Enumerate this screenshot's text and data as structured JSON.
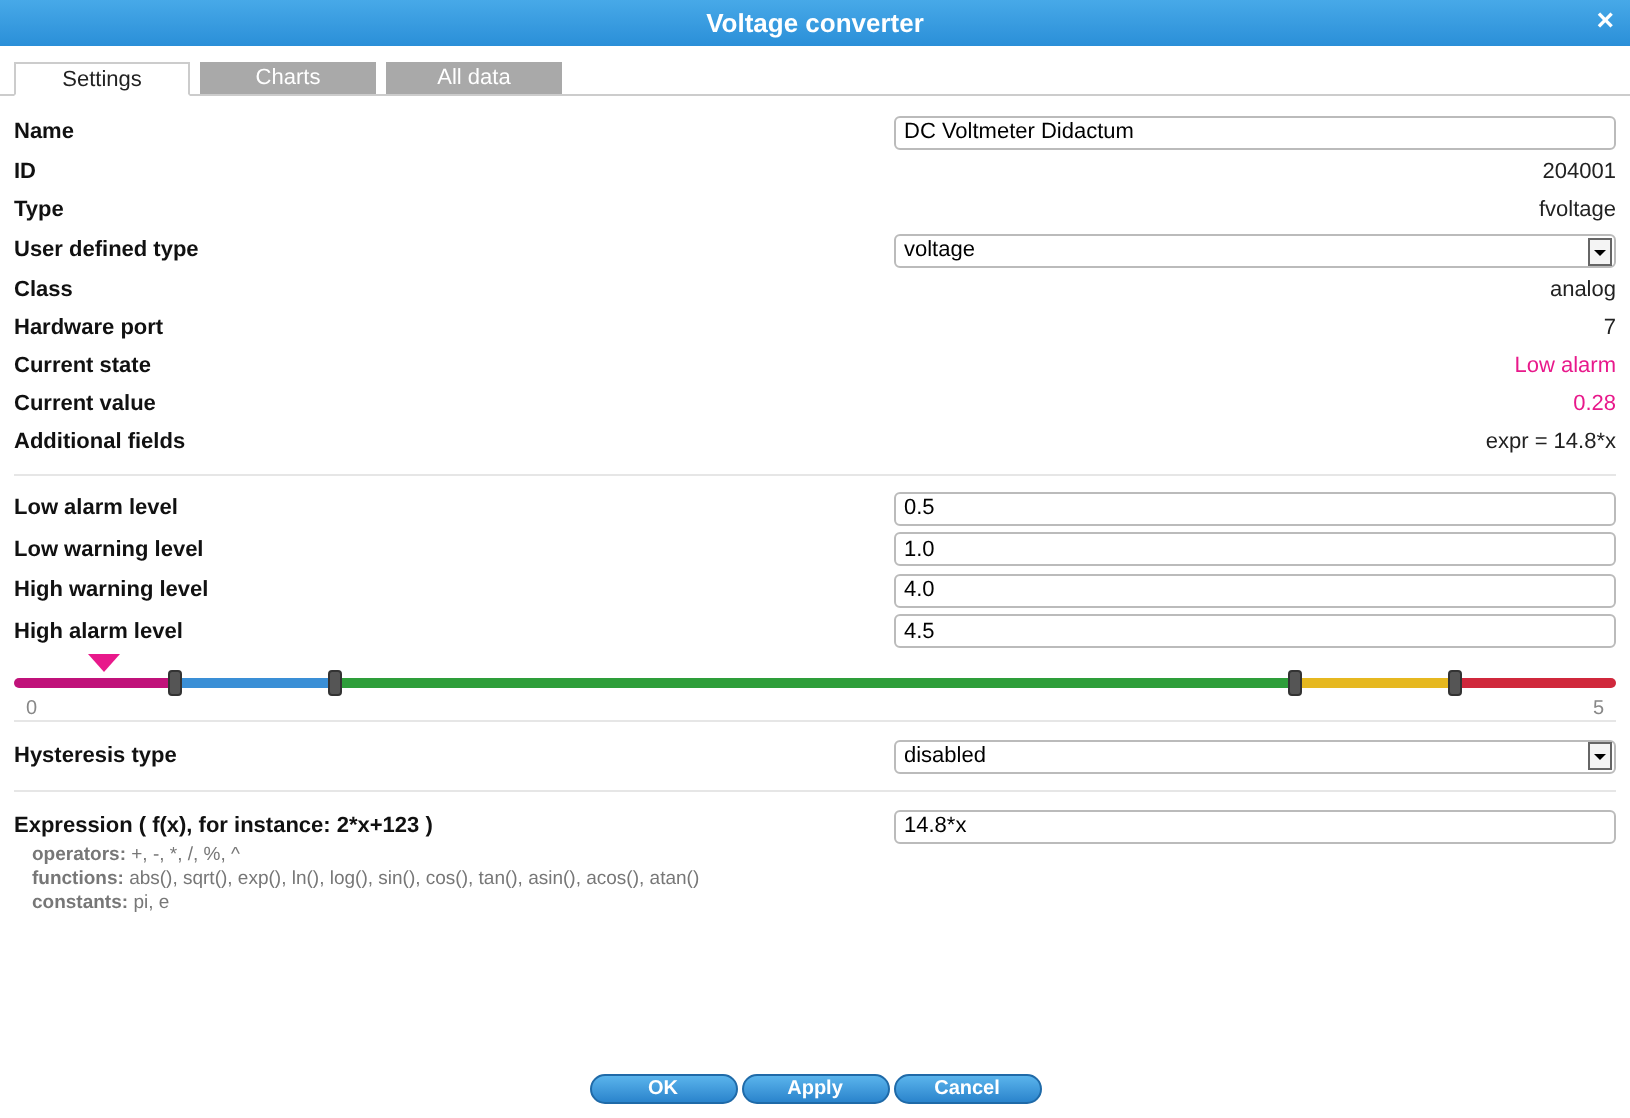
{
  "window": {
    "title": "Voltage converter",
    "close": "×"
  },
  "tabs": [
    {
      "label": "Settings",
      "selected": true
    },
    {
      "label": "Charts",
      "selected": false
    },
    {
      "label": "All data",
      "selected": false
    }
  ],
  "properties": [
    {
      "label": "Name",
      "kind": "input",
      "value": "DC Voltmeter Didactum"
    },
    {
      "label": "ID",
      "kind": "text",
      "value": "204001",
      "alert": false
    },
    {
      "label": "Type",
      "kind": "text",
      "value": "fvoltage",
      "alert": false
    },
    {
      "label": "User defined type",
      "kind": "select",
      "value": "voltage"
    },
    {
      "label": "Class",
      "kind": "text",
      "value": "analog",
      "alert": false
    },
    {
      "label": "Hardware port",
      "kind": "text",
      "value": "7",
      "alert": false
    },
    {
      "label": "Current state",
      "kind": "text",
      "value": "Low alarm",
      "alert": true
    },
    {
      "label": "Current value",
      "kind": "text",
      "value": "0.28",
      "alert": true
    },
    {
      "label": "Additional fields",
      "kind": "text",
      "value": "expr = 14.8*x",
      "alert": false
    }
  ],
  "levels": [
    {
      "label": "Low alarm level",
      "value": "0.5"
    },
    {
      "label": "Low warning level",
      "value": "1.0"
    },
    {
      "label": "High warning level",
      "value": "4.0"
    },
    {
      "label": "High alarm level",
      "value": "4.5"
    }
  ],
  "slider": {
    "marker": {
      "level": 0.056
    },
    "thumbs": [
      {
        "level": 0.1
      },
      {
        "level": 0.2
      },
      {
        "level": 0.8
      },
      {
        "level": 0.9
      }
    ],
    "min_label": "0",
    "max_label": "5"
  },
  "hysteresis": {
    "label": "Hysteresis type",
    "value": "disabled"
  },
  "expression": {
    "label": "Expression ( f(x), for instance: 2*x+123 )",
    "value": "14.8*x",
    "help": [
      {
        "label": "operators:",
        "text": "+, -, *, /, %, ^"
      },
      {
        "label": "functions:",
        "text": "abs(), sqrt(), exp(), ln(), log(), sin(), cos(), tan(), asin(), acos(), atan()"
      },
      {
        "label": "constants:",
        "text": "pi, e"
      }
    ]
  },
  "buttons": [
    "OK",
    "Apply",
    "Cancel"
  ]
}
